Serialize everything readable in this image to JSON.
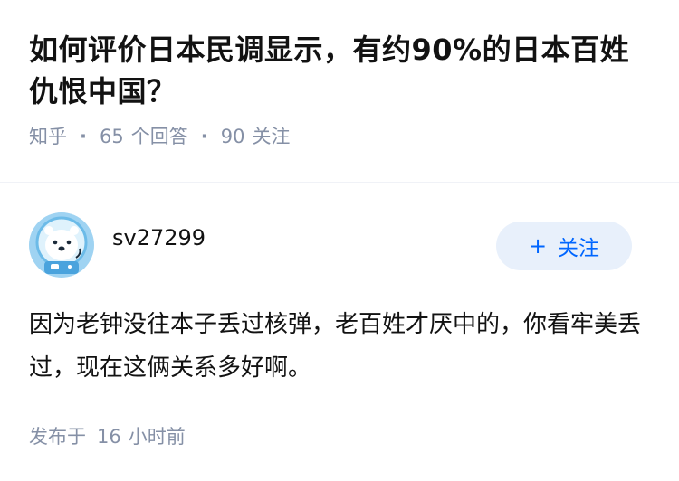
{
  "question": {
    "title": "如何评价日本民调显示，有约90%的日本百姓仇恨中国？",
    "source": "知乎",
    "answer_count": "65",
    "answer_label": "个回答",
    "follow_count": "90",
    "follow_label": "关注"
  },
  "answer": {
    "author": "sv27299",
    "follow_button": "关注",
    "content": "因为老钟没往本子丢过核弹，老百姓才厌中的，你看牢美丢过，现在这俩关系多好啊。",
    "posted_prefix": "发布于",
    "posted_num": "16",
    "posted_suffix": "小时前"
  },
  "colors": {
    "accent": "#0066ff",
    "muted": "#8590a6",
    "button_bg": "#e8f0fb"
  },
  "icons": {
    "avatar": "polar-bear-astronaut-avatar",
    "follow": "plus-icon"
  }
}
